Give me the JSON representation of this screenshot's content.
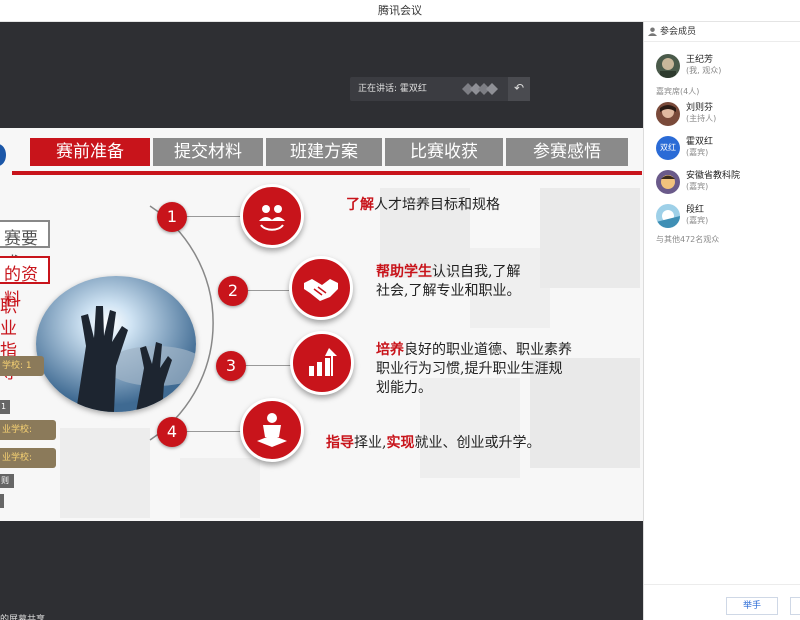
{
  "window": {
    "title": "腾讯会议"
  },
  "speaking": {
    "label": "正在讲话: 霍双红"
  },
  "slide": {
    "tabs": [
      {
        "label": "赛前准备",
        "active": true
      },
      {
        "label": "提交材料",
        "active": false
      },
      {
        "label": "班建方案",
        "active": false
      },
      {
        "label": "比赛收获",
        "active": false
      },
      {
        "label": "参赛感悟",
        "active": false
      }
    ],
    "left_box_gray": "赛要求",
    "left_box_red": "的资料",
    "left_vertical": [
      "职",
      "业",
      "指",
      "导"
    ],
    "points": [
      {
        "num": "1",
        "highlight": "了解",
        "text": "人才培养目标和规格",
        "icon": "team-icon"
      },
      {
        "num": "2",
        "highlight": "帮助学生",
        "text": "认识自我,了解社会,了解专业和职业。",
        "icon": "handshake-icon"
      },
      {
        "num": "3",
        "highlight": "培养",
        "text": "良好的职业道德、职业素养职业行为习惯,提升职业生涯规划能力。",
        "icon": "growth-chart-icon"
      },
      {
        "num": "4",
        "highlight": "指导",
        "text": "择业,实现就业、创业或升学。",
        "icon": "person-guide-icon"
      }
    ],
    "point4_mid": "实现",
    "point4_rest": "就业、创业或升学。",
    "point4_pre": "择业,",
    "point2_line1": "认识自我,了解",
    "point2_line2": "社会,了解专业和职业。",
    "point3_line1": "良好的职业道德、职业素养",
    "point3_line2": "职业行为习惯,提升职业生涯规",
    "point3_line3": "划能力。"
  },
  "chat_overlay": {
    "tag1": "学校: 1",
    "small1": "1",
    "tag2": "业学校:",
    "tag3": "业学校:",
    "small2": "则"
  },
  "panel": {
    "title": "参会成员",
    "self": {
      "name": "王纪芳",
      "role": "(我, 观众)"
    },
    "guest_section": "嘉宾席(4人)",
    "members": [
      {
        "name": "刘则芬",
        "role": "(主持人)",
        "avatar": "avatar-photo",
        "color": "#7a4a3a"
      },
      {
        "name": "霍双红",
        "role": "(嘉宾)",
        "avatar": "双红",
        "color": "#2a6bd6"
      },
      {
        "name": "安徽省教科院",
        "role": "(嘉宾)",
        "avatar": "avatar-photo",
        "color": "#5b4a7a"
      },
      {
        "name": "段红",
        "role": "(嘉宾)",
        "avatar": "avatar-photo",
        "color": "#3f8fb5"
      }
    ],
    "others": "与其他472名观众",
    "raise_hand": "举手"
  },
  "footer": {
    "share_text": "的屏幕共享"
  },
  "colors": {
    "accent_red": "#c8141b",
    "stage_bg": "#2e2f33",
    "link_blue": "#2a6bd6"
  }
}
